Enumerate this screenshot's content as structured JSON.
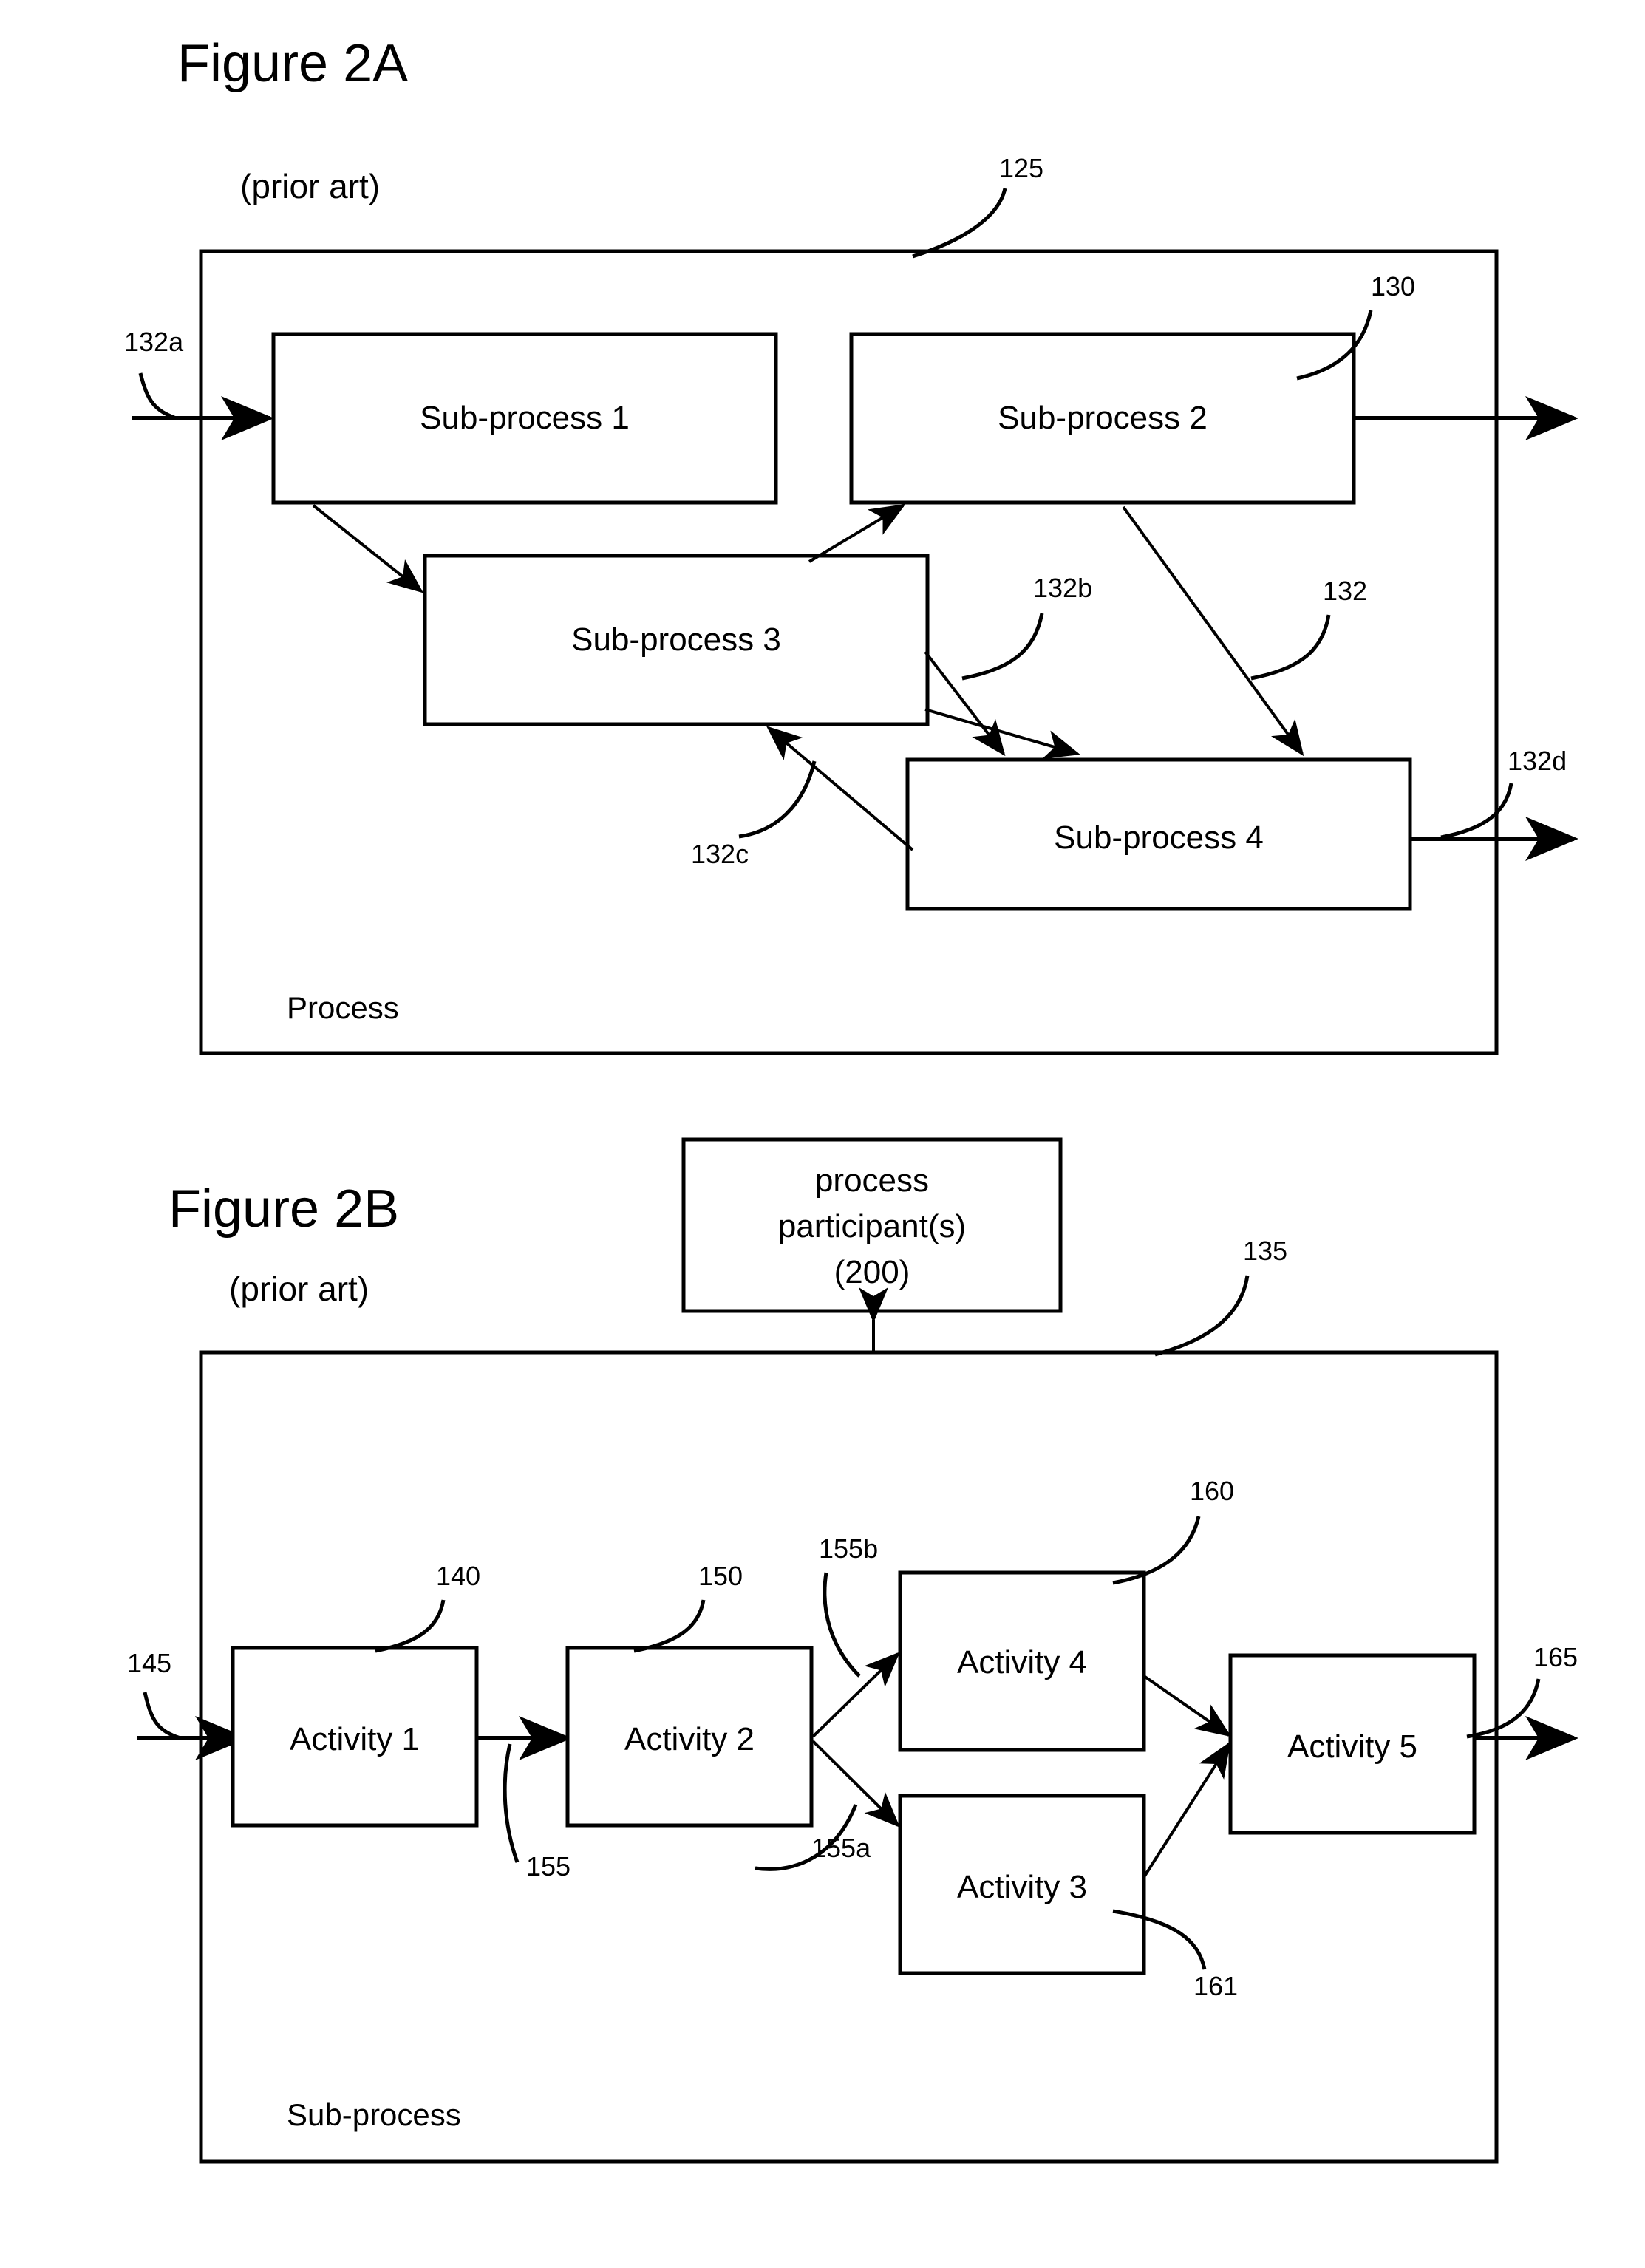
{
  "figures": [
    {
      "id": "fig2a",
      "title": "Figure 2A",
      "subtitle": "(prior art)",
      "container_label": "Process",
      "container_ref": "125",
      "boxes": [
        {
          "key": "sp1",
          "label": "Sub-process 1",
          "ref": ""
        },
        {
          "key": "sp2",
          "label": "Sub-process 2",
          "ref": "130"
        },
        {
          "key": "sp3",
          "label": "Sub-process 3",
          "ref": ""
        },
        {
          "key": "sp4",
          "label": "Sub-process 4",
          "ref": ""
        }
      ],
      "connector_refs": [
        {
          "key": "in_a",
          "ref": "132a"
        },
        {
          "key": "sp3_sp4",
          "ref": "132b"
        },
        {
          "key": "sp2_sp4",
          "ref": "132"
        },
        {
          "key": "sp4_sp3",
          "ref": "132c"
        },
        {
          "key": "out_d",
          "ref": "132d"
        }
      ]
    },
    {
      "id": "fig2b",
      "title": "Figure 2B",
      "subtitle": "(prior art)",
      "container_label": "Sub-process",
      "container_ref": "135",
      "participant_box": {
        "line1": "process",
        "line2": "participant(s)",
        "line3": "(200)"
      },
      "boxes": [
        {
          "key": "a1",
          "label": "Activity 1",
          "ref": "140"
        },
        {
          "key": "a2",
          "label": "Activity 2",
          "ref": "150"
        },
        {
          "key": "a4",
          "label": "Activity 4",
          "ref": "160"
        },
        {
          "key": "a3",
          "label": "Activity 3",
          "ref": "161"
        },
        {
          "key": "a5",
          "label": "Activity 5",
          "ref": ""
        }
      ],
      "connector_refs": [
        {
          "key": "in",
          "ref": "145"
        },
        {
          "key": "a1_a2",
          "ref": "155"
        },
        {
          "key": "a2_a3",
          "ref": "155a"
        },
        {
          "key": "a2_a4",
          "ref": "155b"
        },
        {
          "key": "out",
          "ref": "165"
        }
      ]
    }
  ],
  "colors": {
    "line": "#000000",
    "background": "#ffffff",
    "text": "#000000"
  }
}
